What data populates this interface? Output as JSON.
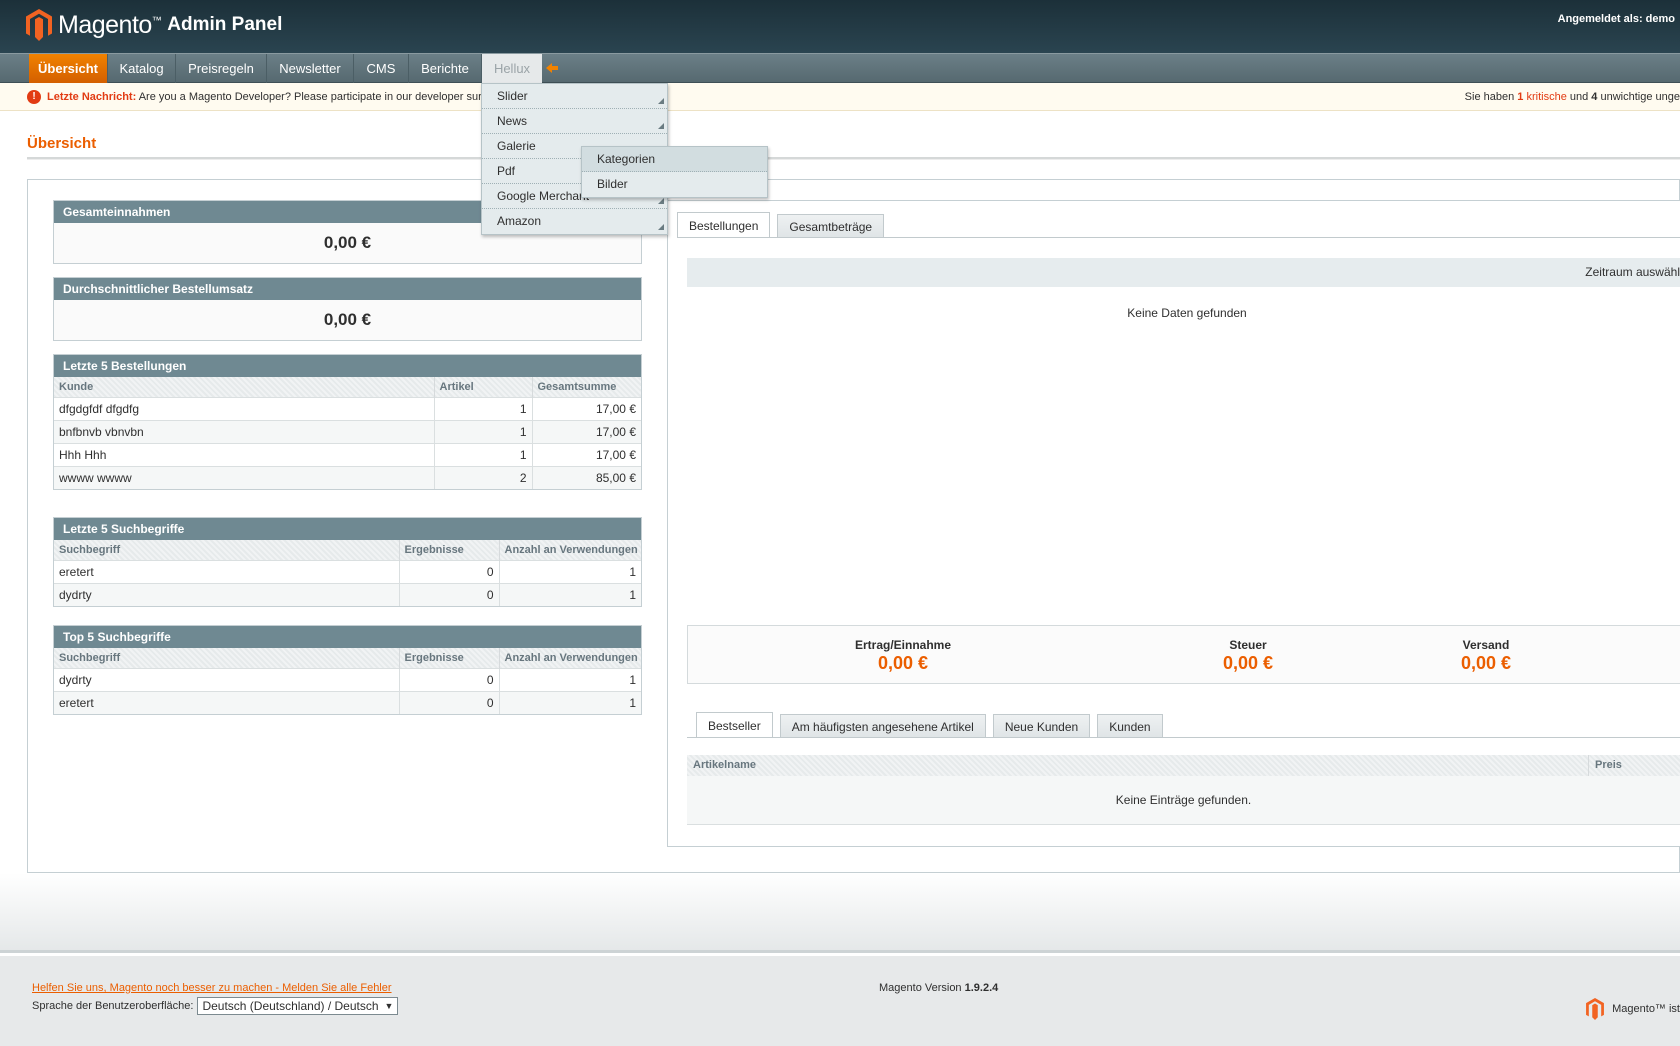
{
  "header": {
    "brand": "Magento",
    "brand_tm": "™",
    "brand_sub": "Admin Panel",
    "login_info": "Angemeldet als: demo"
  },
  "nav": {
    "items": [
      "Übersicht",
      "Katalog",
      "Preisregeln",
      "Newsletter",
      "CMS",
      "Berichte",
      "Hellux"
    ],
    "active": "Übersicht",
    "open": "Hellux",
    "arrow_icon": "arrow-left-icon"
  },
  "dropdown": {
    "items": [
      "Slider",
      "News",
      "Galerie",
      "Pdf",
      "Google Merchant",
      "Amazon"
    ],
    "submenu_parent": "Galerie",
    "submenu_items": [
      "Kategorien",
      "Bilder"
    ]
  },
  "notice": {
    "label": "Letzte Nachricht:",
    "text": "Are you a Magento Developer? Please participate in our developer sur",
    "right_prefix": "Sie haben",
    "critical_count": "1",
    "critical_word": "kritische",
    "and_word": "und",
    "minor_count": "4",
    "right_suffix": "unwichtige unge"
  },
  "page": {
    "title": "Übersicht"
  },
  "stats": {
    "lifetime_sales": {
      "label": "Gesamteinnahmen",
      "value": "0,00 €"
    },
    "avg_order": {
      "label": "Durchschnittlicher Bestellumsatz",
      "value": "0,00 €"
    }
  },
  "last_orders": {
    "title": "Letzte 5 Bestellungen",
    "columns": [
      "Kunde",
      "Artikel",
      "Gesamtsumme"
    ],
    "rows": [
      [
        "dfgdgfdf dfgdfg",
        "1",
        "17,00 €"
      ],
      [
        "bnfbnvb vbnvbn",
        "1",
        "17,00 €"
      ],
      [
        "Hhh Hhh",
        "1",
        "17,00 €"
      ],
      [
        "wwww wwww",
        "2",
        "85,00 €"
      ]
    ]
  },
  "last_searches": {
    "title": "Letzte 5 Suchbegriffe",
    "columns": [
      "Suchbegriff",
      "Ergebnisse",
      "Anzahl an Verwendungen"
    ],
    "rows": [
      [
        "eretert",
        "0",
        "1"
      ],
      [
        "dydrty",
        "0",
        "1"
      ]
    ]
  },
  "top_searches": {
    "title": "Top 5 Suchbegriffe",
    "columns": [
      "Suchbegriff",
      "Ergebnisse",
      "Anzahl an Verwendungen"
    ],
    "rows": [
      [
        "dydrty",
        "0",
        "1"
      ],
      [
        "eretert",
        "0",
        "1"
      ]
    ]
  },
  "chart_panel": {
    "tabs": [
      "Bestellungen",
      "Gesamtbeträge"
    ],
    "active_tab": "Bestellungen",
    "range_label": "Zeitraum auswähl",
    "empty_text": "Keine Daten gefunden"
  },
  "totals": [
    {
      "label": "Ertrag/Einnahme",
      "value": "0,00 €"
    },
    {
      "label": "Steuer",
      "value": "0,00 €"
    },
    {
      "label": "Versand",
      "value": "0,00 €"
    }
  ],
  "grids_panel": {
    "tabs": [
      "Bestseller",
      "Am häufigsten angesehene Artikel",
      "Neue Kunden",
      "Kunden"
    ],
    "active_tab": "Bestseller",
    "columns": [
      "Artikelname",
      "Preis"
    ],
    "empty_text": "Keine Einträge gefunden."
  },
  "footer": {
    "help_link": "Helfen Sie uns, Magento noch besser zu machen - Melden Sie alle Fehler",
    "lang_label": "Sprache der Benutzeroberfläche:",
    "lang_value": "Deutsch (Deutschland) / Deutsch",
    "version_label": "Magento Version",
    "version_number": "1.9.2.4",
    "brand_text": "Magento™ ist"
  },
  "colors": {
    "accent": "#eb5e00",
    "header_bg": "#1c3039",
    "section_head": "#6f8992",
    "critical": "#e23b13"
  }
}
